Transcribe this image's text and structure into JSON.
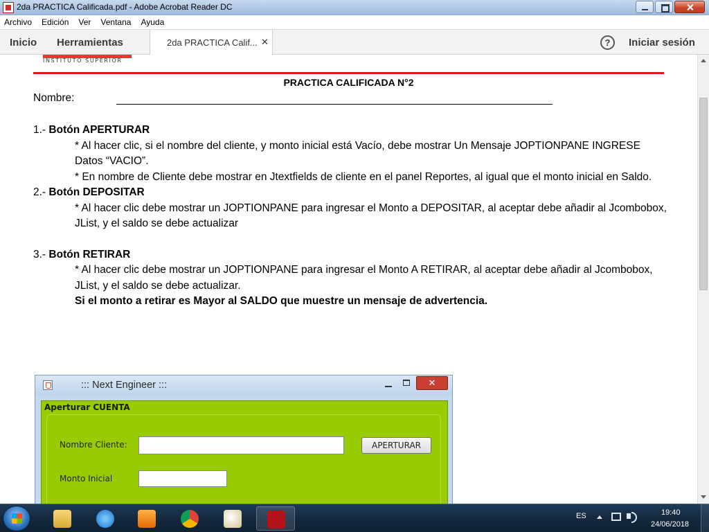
{
  "window": {
    "title": "2da PRACTICA Calificada.pdf - Adobe Acrobat Reader DC"
  },
  "menu": [
    "Archivo",
    "Edición",
    "Ver",
    "Ventana",
    "Ayuda"
  ],
  "toolbar": {
    "home": "Inicio",
    "tools": "Herramientas",
    "doc_tab": "2da PRACTICA Calif...",
    "close_glyph": "✕",
    "help_glyph": "?",
    "signin": "Iniciar sesión"
  },
  "document": {
    "logo_sub": "INSTITUTO SUPERIOR",
    "title": "PRACTICA CALIFICADA N°2",
    "name_label": "Nombre:",
    "sections": [
      {
        "number": "1.-",
        "heading": "Botón APERTURAR",
        "paras": [
          "* Al hacer clic, si el nombre del cliente, y monto inicial está Vacío, debe mostrar Un Mensaje JOPTIONPANE INGRESE Datos “VACIO”.",
          "* En nombre de Cliente debe mostrar en Jtextfields de cliente en el panel Reportes, al igual que el monto inicial en Saldo."
        ]
      },
      {
        "number": "2.-",
        "heading": "Botón DEPOSITAR",
        "paras": [
          "* Al hacer clic debe mostrar un JOPTIONPANE para ingresar el Monto a DEPOSITAR, al aceptar debe añadir al Jcombobox, JList, y el saldo se debe actualizar"
        ]
      },
      {
        "number": "3.-",
        "heading": "Botón RETIRAR",
        "paras": [
          "* Al hacer clic debe mostrar un JOPTIONPANE para ingresar el Monto A RETIRAR, al aceptar debe añadir al Jcombobox, JList, y el saldo se debe actualizar."
        ],
        "bold_note": "Si el monto a retirar es Mayor al SALDO que muestre un mensaje de advertencia."
      }
    ],
    "embedded_app": {
      "title": "::: Next Engineer :::",
      "close_glyph": "✕",
      "panel_title": "Aperturar CUENTA",
      "name_label": "Nombre Cliente:",
      "amount_label": "Monto Inicial",
      "button": "APERTURAR"
    }
  },
  "taskbar": {
    "apps": [
      "windows-explorer-icon",
      "internet-explorer-icon",
      "media-player-icon",
      "chrome-icon",
      "paint-icon",
      "acrobat-reader-icon"
    ],
    "lang": "ES",
    "time": "19:40",
    "date": "24/06/2018"
  },
  "colors": {
    "accent_red": "#d9191f",
    "panel_green": "#99cc00"
  }
}
